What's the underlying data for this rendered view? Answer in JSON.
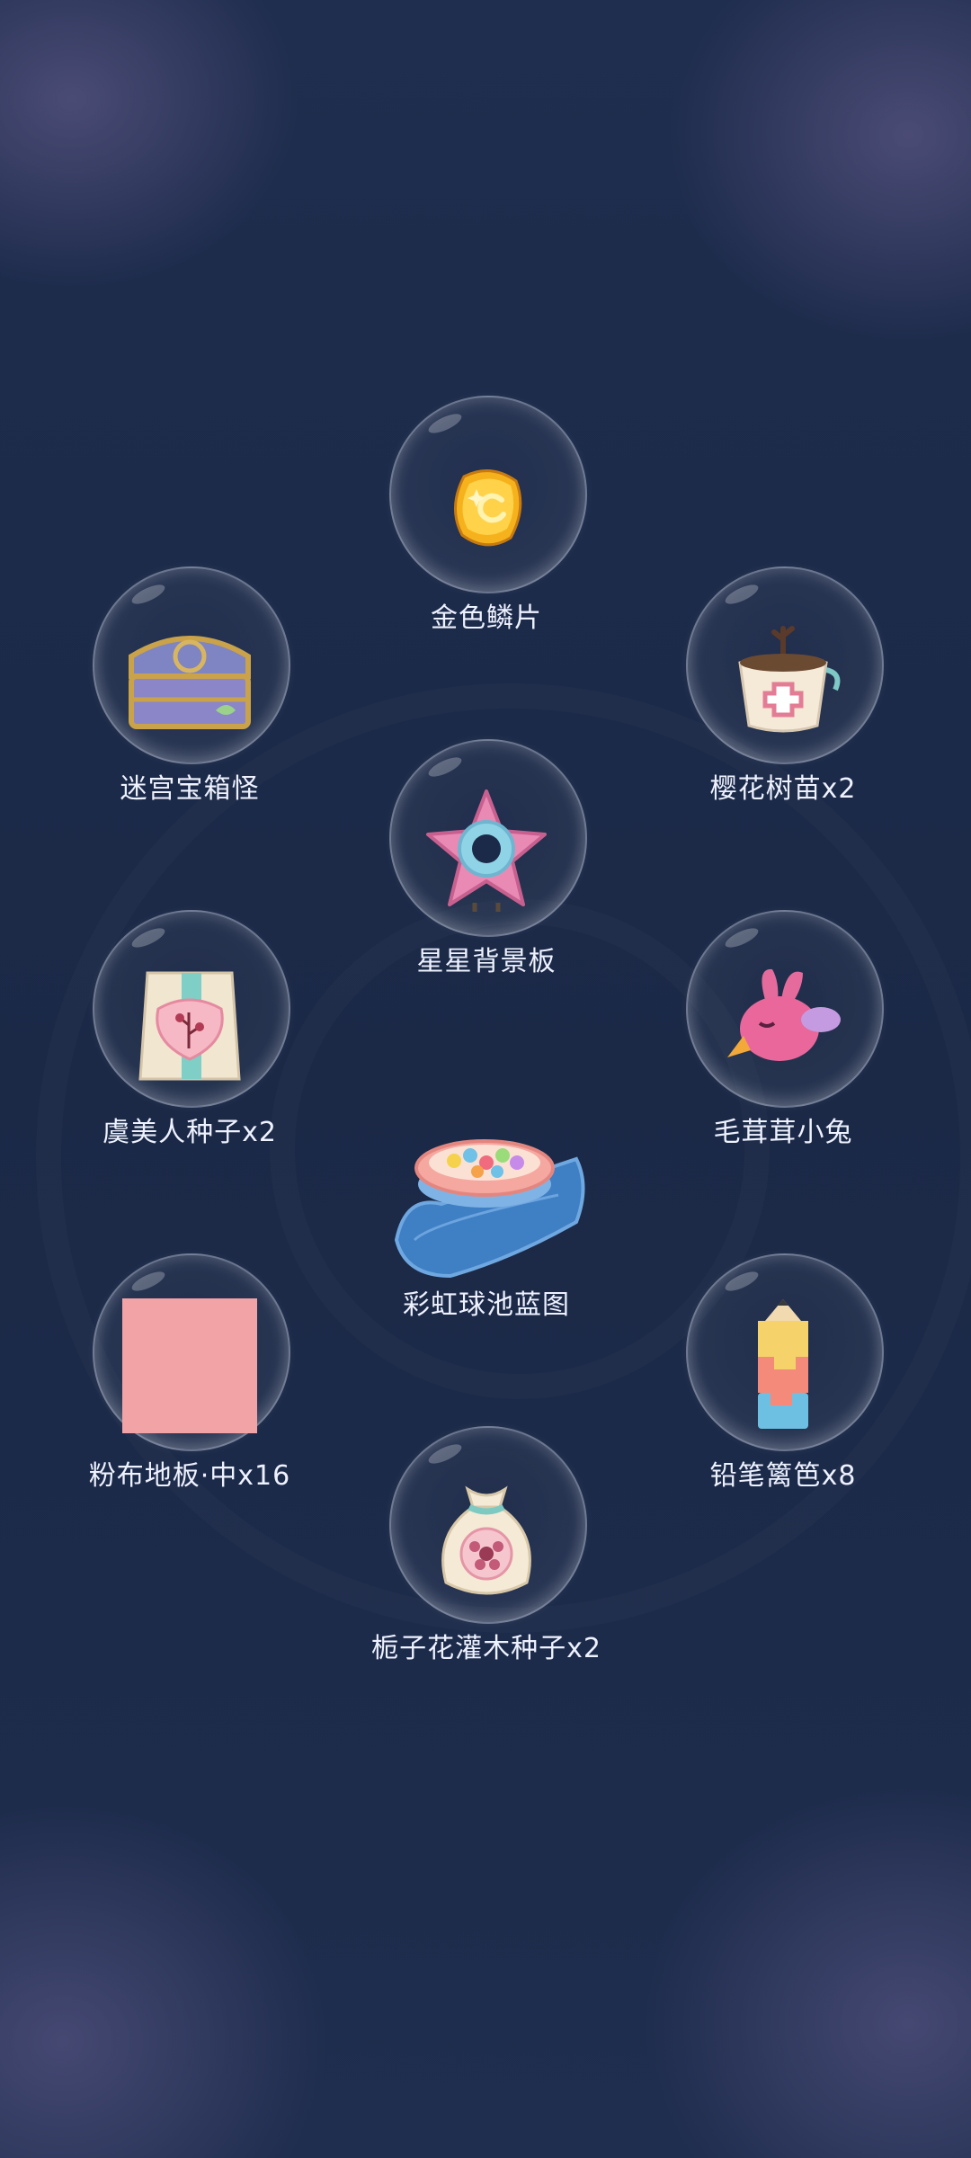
{
  "rewards": [
    {
      "id": "golden-scale",
      "label": "金色鳞片",
      "icon": "golden-scale-icon"
    },
    {
      "id": "maze-chest-monster",
      "label": "迷宫宝箱怪",
      "icon": "treasure-chest-icon"
    },
    {
      "id": "sakura-sapling",
      "label": "樱花树苗x2",
      "icon": "sapling-pot-icon"
    },
    {
      "id": "star-backdrop",
      "label": "星星背景板",
      "icon": "star-board-icon"
    },
    {
      "id": "poppy-seeds",
      "label": "虞美人种子x2",
      "icon": "seed-packet-icon"
    },
    {
      "id": "fluffy-bunny",
      "label": "毛茸茸小兔",
      "icon": "pink-bunny-icon"
    },
    {
      "id": "rainbow-ball-pit",
      "label": "彩虹球池蓝图",
      "icon": "ball-pit-blueprint-icon"
    },
    {
      "id": "pink-cloth-floor",
      "label": "粉布地板·中x16",
      "icon": "pink-floor-tile-icon"
    },
    {
      "id": "pencil-fence",
      "label": "铅笔篱笆x8",
      "icon": "pencil-fence-icon"
    },
    {
      "id": "gardenia-seeds",
      "label": "栀子花灌木种子x2",
      "icon": "seed-bag-icon"
    }
  ],
  "colors": {
    "background": "#1c2a4a",
    "label": "#eef2ff",
    "floor_tile": "#f2a3a6"
  }
}
